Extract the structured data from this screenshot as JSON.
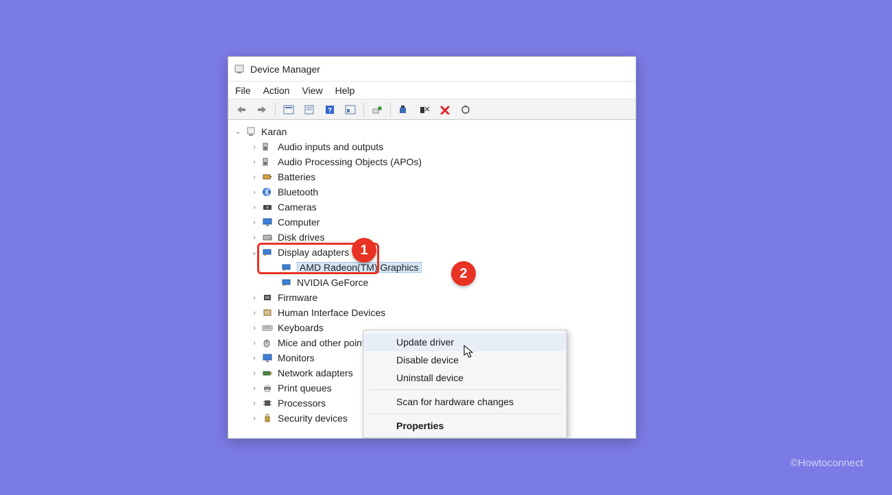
{
  "watermark": "©Howtoconnect",
  "window": {
    "title": "Device Manager"
  },
  "menubar": [
    "File",
    "Action",
    "View",
    "Help"
  ],
  "callouts": {
    "one": "1",
    "two": "2"
  },
  "tree": {
    "root": "Karan",
    "items": [
      "Audio inputs and outputs",
      "Audio Processing Objects (APOs)",
      "Batteries",
      "Bluetooth",
      "Cameras",
      "Computer",
      "Disk drives",
      "Display adapters",
      "Firmware",
      "Human Interface Devices",
      "Keyboards",
      "Mice and other pointing devices",
      "Monitors",
      "Network adapters",
      "Print queues",
      "Processors",
      "Security devices"
    ],
    "display_adapters": {
      "children": [
        "AMD Radeon(TM) Graphics",
        "NVIDIA GeForce"
      ]
    }
  },
  "context_menu": {
    "update": "Update driver",
    "disable": "Disable device",
    "uninstall": "Uninstall device",
    "scan": "Scan for hardware changes",
    "properties": "Properties"
  }
}
